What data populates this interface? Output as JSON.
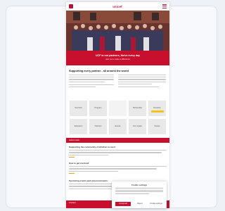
{
  "site": {
    "brand": "unicef",
    "accent": "#c8102e"
  },
  "hero": {
    "headline": "UCF in our partners, thrive every day",
    "subline": "Join us to make a difference"
  },
  "intro": {
    "title": "Supporting every partner - all around the world"
  },
  "tiles": {
    "row1": [
      "Overview",
      "Program",
      "",
      "Partnership",
      "Donation"
    ],
    "row2": [
      "Education",
      "Partners",
      "Events",
      "Our impact",
      "Stories"
    ]
  },
  "news": {
    "section_title": "Latest news",
    "items": [
      {
        "title": "Supporting the community of children in need"
      },
      {
        "title": "How to get involved"
      },
      {
        "title": "Upcoming events and announcements"
      }
    ]
  },
  "footer": {
    "title": "Contact"
  },
  "cookie": {
    "title": "Cookie settings",
    "accept": "Accept all",
    "reject": "Reject",
    "settings": "Cookie settings"
  }
}
